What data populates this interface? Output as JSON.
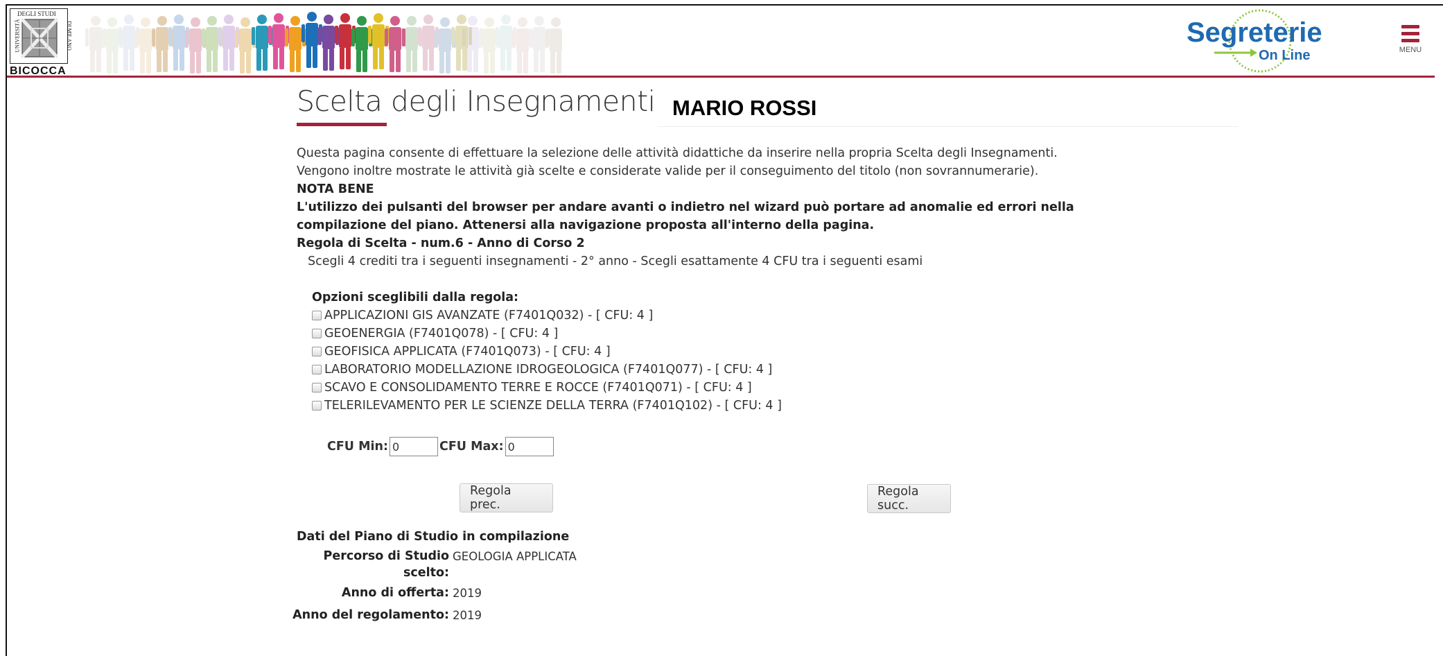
{
  "header": {
    "university_logo": {
      "top_text": "DEGLI STUDI",
      "left_text": "UNIVERSITÀ",
      "right_text": "DI MILANO",
      "bottom_text": "BICOCCA"
    },
    "sol_logo": {
      "line1": "Segreterie",
      "line2": "On Line"
    },
    "menu_label": "MENU",
    "accent_color": "#a3233a"
  },
  "page": {
    "title": "Scelta degli Insegnamenti di:",
    "student_name": "MARIO ROSSI"
  },
  "content": {
    "intro": "Questa pagina consente di effettuare la selezione delle attività didattiche da inserire nella propria Scelta degli Insegnamenti. Vengono inoltre mostrate le attività già scelte e considerate valide per il conseguimento del titolo (non sovrannumerarie).",
    "nota_bene_label": "NOTA BENE",
    "nota_bene_text": "L'utilizzo dei pulsanti del browser per andare avanti o indietro nel wizard può portare ad anomalie ed errori nella compilazione del piano. Attenersi alla navigazione proposta all'interno della pagina.",
    "rule_title": "Regola di Scelta - num.6 - Anno di Corso 2",
    "rule_description": "Scegli 4 crediti tra i seguenti insegnamenti - 2° anno - Scegli esattamente 4 CFU tra i seguenti esami",
    "options_title": "Opzioni sceglibili dalla regola:",
    "options": [
      {
        "label": "APPLICAZIONI GIS AVANZATE (F7401Q032) - [ CFU: 4 ]",
        "checked": false
      },
      {
        "label": "GEOENERGIA (F7401Q078) - [ CFU: 4 ]",
        "checked": false
      },
      {
        "label": "GEOFISICA APPLICATA (F7401Q073) - [ CFU: 4 ]",
        "checked": false
      },
      {
        "label": "LABORATORIO MODELLAZIONE IDROGEOLOGICA (F7401Q077) - [ CFU: 4 ]",
        "checked": false
      },
      {
        "label": "SCAVO E CONSOLIDAMENTO TERRE E ROCCE (F7401Q071) - [ CFU: 4 ]",
        "checked": false
      },
      {
        "label": "TELERILEVAMENTO PER LE SCIENZE DELLA TERRA (F7401Q102) - [ CFU: 4 ]",
        "checked": false
      }
    ],
    "cfu_min_label": "CFU Min:",
    "cfu_min_value": "0",
    "cfu_max_label": "CFU Max:",
    "cfu_max_value": "0"
  },
  "navigation": {
    "prev_label": "Regola prec.",
    "next_label": "Regola succ."
  },
  "piano": {
    "title": "Dati del Piano di Studio in compilazione",
    "percorso_label_line1": "Percorso di Studio",
    "percorso_label_line2": "scelto:",
    "percorso_value": "GEOLOGIA APPLICATA",
    "anno_offerta_label": "Anno di offerta:",
    "anno_offerta_value": "2019",
    "anno_regolamento_label": "Anno del regolamento:",
    "anno_regolamento_value": "2019"
  }
}
